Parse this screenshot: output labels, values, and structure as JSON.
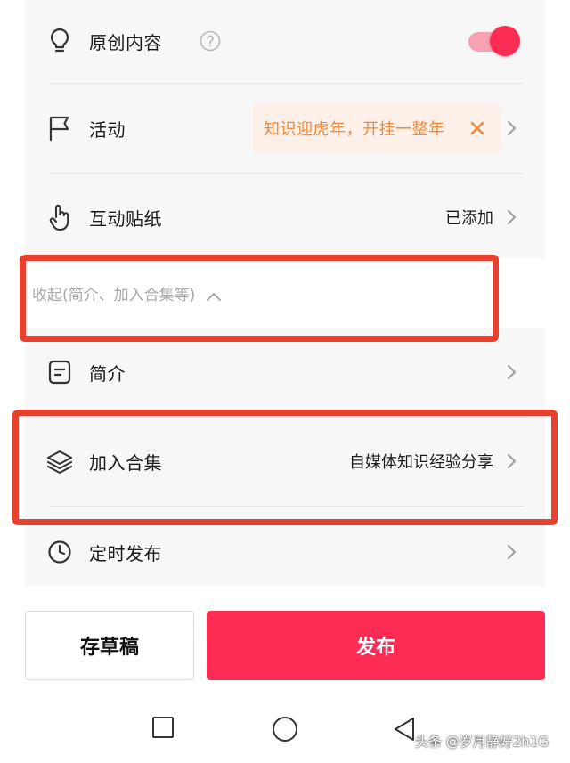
{
  "settings": {
    "original": {
      "label": "原创内容",
      "toggle_on": true
    },
    "activity": {
      "label": "活动",
      "tag": "知识迎虎年，开挂一整年"
    },
    "sticker": {
      "label": "互动贴纸",
      "value": "已添加"
    },
    "collapse": {
      "label": "收起(简介、加入合集等)"
    },
    "intro": {
      "label": "简介"
    },
    "collection": {
      "label": "加入合集",
      "value": "自媒体知识经验分享"
    },
    "schedule": {
      "label": "定时发布"
    }
  },
  "actions": {
    "draft_label": "存草稿",
    "publish_label": "发布"
  },
  "nav_icons": [
    "square-icon",
    "circle-icon",
    "triangle-back-icon"
  ],
  "watermark": "头条 @岁月静好2h1G",
  "colors": {
    "accent": "#fc2c55",
    "highlight_border": "#e8402e",
    "tag_text": "#f08a3c",
    "tag_bg": "#fdf0e8"
  }
}
